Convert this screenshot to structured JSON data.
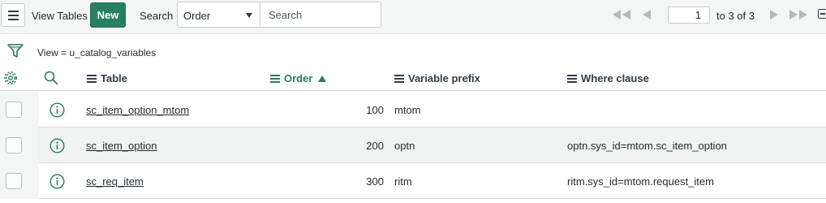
{
  "toolbar": {
    "view_tables_label": "View Tables",
    "new_label": "New",
    "search_label": "Search",
    "search_field": "Order",
    "search_placeholder": "Search"
  },
  "pager": {
    "current_page": "1",
    "range_text": "to 3 of 3"
  },
  "filter": {
    "breadcrumb": "View = u_catalog_variables"
  },
  "columns": {
    "table": "Table",
    "order": "Order",
    "variable_prefix": "Variable prefix",
    "where_clause": "Where clause"
  },
  "sort": {
    "column": "Order",
    "direction": "ascending"
  },
  "rows": [
    {
      "table": "sc_item_option_mtom",
      "order": "100",
      "prefix": "mtom",
      "where": ""
    },
    {
      "table": "sc_item_option",
      "order": "200",
      "prefix": "optn",
      "where": "optn.sys_id=mtom.sc_item_option"
    },
    {
      "table": "sc_req_item",
      "order": "300",
      "prefix": "ritm",
      "where": "ritm.sys_id=mtom.request_item"
    }
  ],
  "colors": {
    "accent": "#278062",
    "sorted_header": "#2c7b5f",
    "toolbar_bg": "#f4f5f5"
  }
}
